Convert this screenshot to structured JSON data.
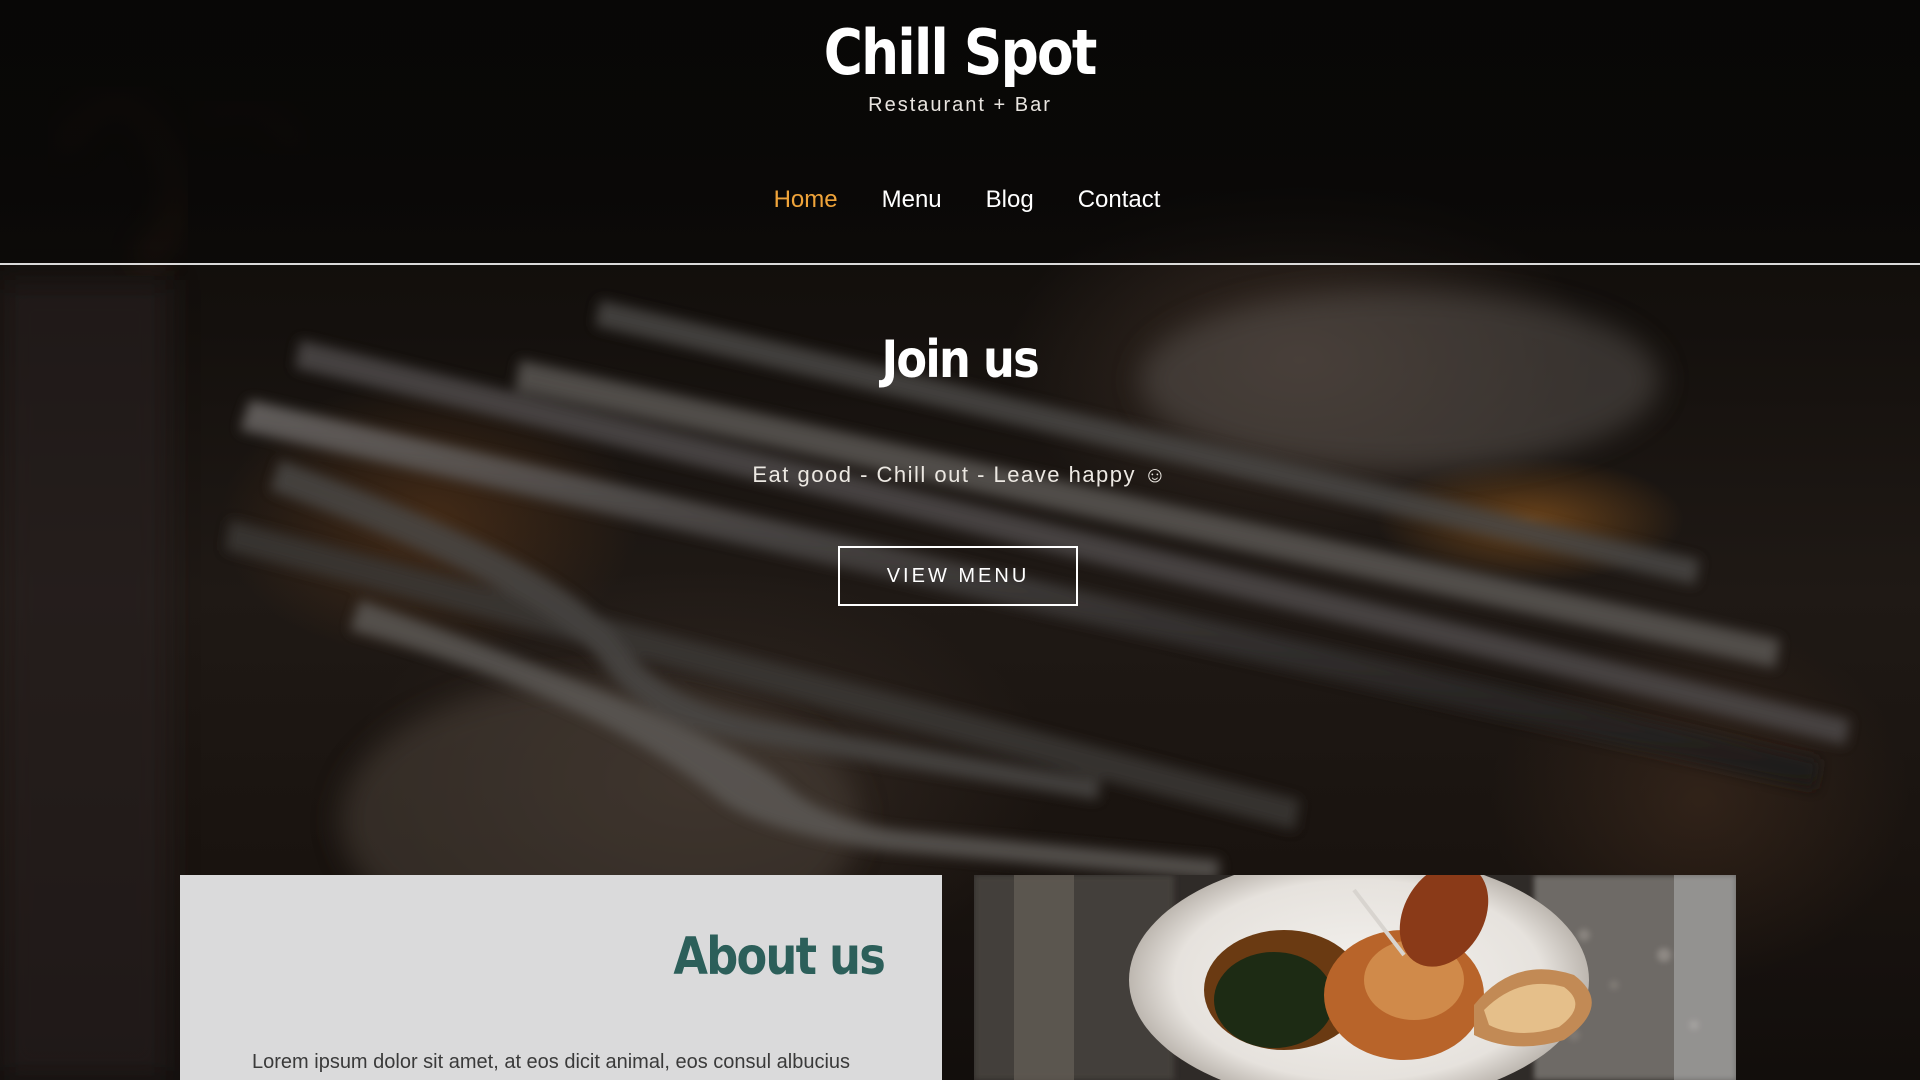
{
  "site": {
    "logo": "Chill Spot",
    "tagline": "Restaurant + Bar"
  },
  "nav": {
    "items": [
      {
        "label": "Home",
        "active": true
      },
      {
        "label": "Menu",
        "active": false
      },
      {
        "label": "Blog",
        "active": false
      },
      {
        "label": "Contact",
        "active": false
      }
    ]
  },
  "hero": {
    "title": "Join us",
    "subtitle": "Eat good - Chill out - Leave happy ☺",
    "button_label": "VIEW MENU"
  },
  "about": {
    "title": "About us",
    "text": "Lorem ipsum dolor sit amet, at eos dicit animal, eos consul albucius"
  },
  "colors": {
    "accent": "#f0a43a",
    "about_title": "#2c5f5a",
    "about_card_bg": "#dadadb"
  },
  "images": {
    "hero_background": "cutlery-background-photo",
    "about_photo": "roast-chicken-plate-photo"
  }
}
